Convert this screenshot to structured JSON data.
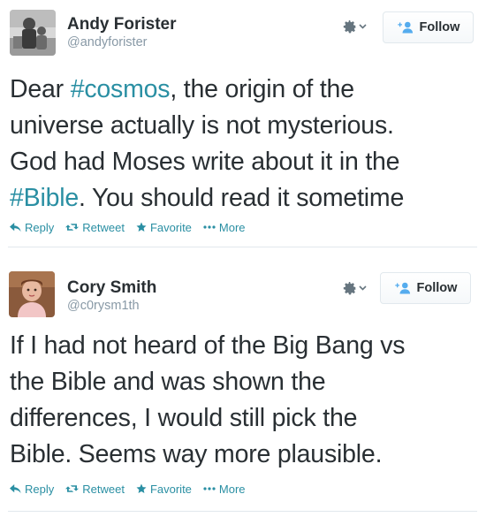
{
  "tweets": [
    {
      "author_name": "Andy Forister",
      "author_handle": "@andyforister",
      "follow_label": "Follow",
      "text_lines": [
        [
          {
            "t": "Dear ",
            "tag": false
          },
          {
            "t": "#cosmos",
            "tag": true
          },
          {
            "t": ", the origin of the",
            "tag": false
          }
        ],
        [
          {
            "t": "universe actually is not mysterious.",
            "tag": false
          }
        ],
        [
          {
            "t": "God had Moses write about it in the",
            "tag": false
          }
        ],
        [
          {
            "t": "#Bible",
            "tag": true
          },
          {
            "t": ". You should read it sometime",
            "tag": false
          }
        ]
      ],
      "actions": {
        "reply": "Reply",
        "retweet": "Retweet",
        "favorite": "Favorite",
        "more": "More"
      }
    },
    {
      "author_name": "Cory Smith",
      "author_handle": "@c0rysm1th",
      "follow_label": "Follow",
      "text_lines": [
        [
          {
            "t": "If I had not heard of the Big Bang vs",
            "tag": false
          }
        ],
        [
          {
            "t": "the Bible and was shown the",
            "tag": false
          }
        ],
        [
          {
            "t": "differences, I would still pick the",
            "tag": false
          }
        ],
        [
          {
            "t": "Bible. Seems way more plausible.",
            "tag": false
          }
        ]
      ],
      "actions": {
        "reply": "Reply",
        "retweet": "Retweet",
        "favorite": "Favorite",
        "more": "More"
      }
    }
  ],
  "icons": {
    "avatar_1": "avatar-photo-icon",
    "avatar_2": "avatar-photo-icon",
    "gear": "gear-icon",
    "caret": "chevron-down-icon",
    "follow": "add-user-icon",
    "reply": "reply-arrow-icon",
    "retweet": "retweet-icon",
    "favorite": "star-icon",
    "more": "ellipsis-icon"
  },
  "colors": {
    "link": "#2a8fa3",
    "follow_icon": "#55acee",
    "text": "#292f33",
    "secondary": "#8899a6"
  }
}
